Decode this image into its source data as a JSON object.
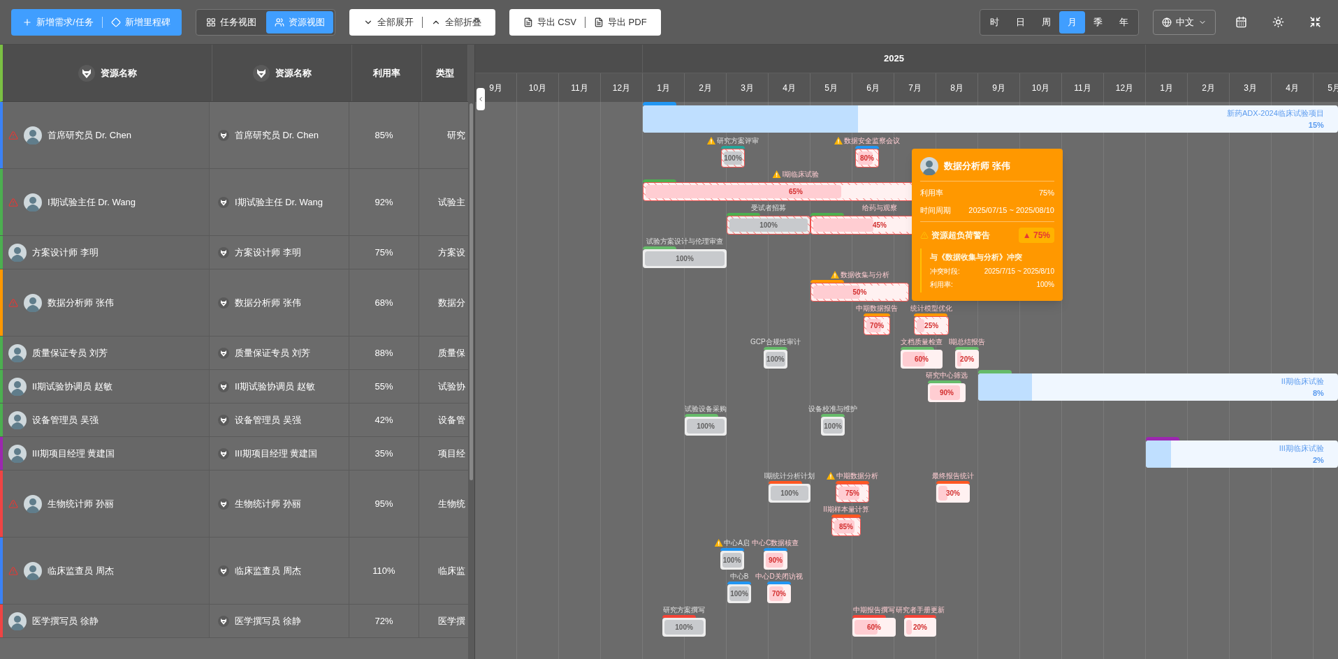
{
  "toolbar": {
    "create_buttons": [
      "新增需求/任务",
      "新增里程碑"
    ],
    "views": [
      {
        "label": "任务视图",
        "selected": false,
        "kind": "grid"
      },
      {
        "label": "资源视图",
        "selected": true,
        "kind": "users"
      }
    ],
    "expand_buttons": [
      {
        "label": "全部展开",
        "kind": "down"
      },
      {
        "label": "全部折叠",
        "kind": "up"
      }
    ],
    "export_buttons": [
      "导出 CSV",
      "导出 PDF"
    ],
    "scales": [
      {
        "label": "时",
        "selected": false
      },
      {
        "label": "日",
        "selected": false
      },
      {
        "label": "周",
        "selected": false
      },
      {
        "label": "月",
        "selected": true
      },
      {
        "label": "季",
        "selected": false
      },
      {
        "label": "年",
        "selected": false
      }
    ],
    "language": "中文"
  },
  "table": {
    "columns": [
      "资源名称",
      "资源名称",
      "利用率",
      "类型"
    ],
    "rows": [
      {
        "name": "首席研究员 Dr. Chen",
        "resource": "首席研究员 Dr. Chen",
        "utilization": "85%",
        "type": "研究",
        "color": "#3b82f6",
        "warning": true
      },
      {
        "name": "I期试验主任 Dr. Wang",
        "resource": "I期试验主任 Dr. Wang",
        "utilization": "92%",
        "type": "试验主",
        "color": "#4caf50",
        "warning": true
      },
      {
        "name": "方案设计师 李明",
        "resource": "方案设计师 李明",
        "utilization": "75%",
        "type": "方案设",
        "color": "#4caf50",
        "warning": false
      },
      {
        "name": "数据分析师 张伟",
        "resource": "数据分析师 张伟",
        "utilization": "68%",
        "type": "数据分",
        "color": "#ff9800",
        "warning": true
      },
      {
        "name": "质量保证专员 刘芳",
        "resource": "质量保证专员 刘芳",
        "utilization": "88%",
        "type": "质量保",
        "color": "#4caf50",
        "warning": false
      },
      {
        "name": "II期试验协调员 赵敏",
        "resource": "II期试验协调员 赵敏",
        "utilization": "55%",
        "type": "试验协",
        "color": "#4caf50",
        "warning": false
      },
      {
        "name": "设备管理员 吴强",
        "resource": "设备管理员 吴强",
        "utilization": "42%",
        "type": "设备管",
        "color": "#4caf50",
        "warning": false
      },
      {
        "name": "III期项目经理 黄建国",
        "resource": "III期项目经理 黄建国",
        "utilization": "35%",
        "type": "项目经",
        "color": "#9c27b0",
        "warning": false
      },
      {
        "name": "生物统计师 孙丽",
        "resource": "生物统计师 孙丽",
        "utilization": "95%",
        "type": "生物统",
        "color": "#ef4444",
        "warning": true
      },
      {
        "name": "临床监查员 周杰",
        "resource": "临床监查员 周杰",
        "utilization": "110%",
        "type": "临床监",
        "color": "#3b82f6",
        "warning": true
      },
      {
        "name": "医学撰写员 徐静",
        "resource": "医学撰写员 徐静",
        "utilization": "72%",
        "type": "医学撰",
        "color": "#ef4444",
        "warning": false
      }
    ]
  },
  "timeline": {
    "groups": [
      {
        "months": [
          "9月",
          "10月",
          "11月",
          "12月"
        ]
      },
      {
        "label": "2025",
        "months": [
          "1月",
          "2月",
          "3月",
          "4月",
          "5月",
          "6月",
          "7月",
          "8月",
          "9月",
          "10月",
          "11月",
          "12月"
        ]
      },
      {
        "months": [
          "1月",
          "2月",
          "3月",
          "4月",
          "5月"
        ]
      }
    ],
    "rows": [
      {
        "lanes": [
          [
            {
              "kind": "project",
              "name": "新药ADX-2024临床试验项目",
              "percent": "15%",
              "level": 0.31,
              "color": "#2196f3"
            }
          ],
          [
            {
              "kind": "task",
              "name": "研究方案评审",
              "percent": "100%",
              "level": 1,
              "color": "#26a69a",
              "overloaded": false,
              "conflict": true,
              "warning": true
            },
            {
              "kind": "task",
              "name": "数据安全监察会议",
              "percent": "80%",
              "level": 0.8,
              "color": "#2196f3",
              "overloaded": true,
              "conflict": true,
              "warning": true
            }
          ]
        ]
      },
      {
        "lanes": [
          [
            {
              "kind": "task",
              "name": "I期临床试验",
              "percent": "65%",
              "level": 0.65,
              "color": "#4caf50",
              "overloaded": true,
              "conflict": true,
              "warning": true
            }
          ],
          [
            {
              "kind": "task",
              "name": "受试者招募",
              "percent": "100%",
              "level": 1,
              "color": "#4caf50",
              "overloaded": false,
              "conflict": true,
              "warning": false
            },
            {
              "kind": "task",
              "name": "给药与观察",
              "percent": "45%",
              "level": 0.45,
              "color": "#4caf50",
              "overloaded": true,
              "conflict": true,
              "warning": false
            }
          ]
        ]
      },
      {
        "lanes": [
          [
            {
              "kind": "task",
              "name": "试验方案设计与伦理审查",
              "percent": "100%",
              "level": 1,
              "color": "#66bb6a",
              "overloaded": false,
              "conflict": false,
              "warning": false
            }
          ]
        ]
      },
      {
        "lanes": [
          [
            {
              "kind": "task",
              "name": "数据收集与分析",
              "percent": "50%",
              "level": 0.5,
              "color": "#ff9800",
              "overloaded": true,
              "conflict": true,
              "warning": true
            }
          ],
          [
            {
              "kind": "task",
              "name": "中期数据报告",
              "percent": "70%",
              "level": 0.7,
              "color": "#ff9800",
              "overloaded": true,
              "conflict": true,
              "warning": false
            },
            {
              "kind": "task",
              "name": "统计模型优化",
              "percent": "25%",
              "level": 0.25,
              "color": "#ff9800",
              "overloaded": true,
              "conflict": true,
              "warning": false
            }
          ]
        ]
      },
      {
        "lanes": [
          [
            {
              "kind": "task",
              "name": "GCP合规性审计",
              "percent": "100%",
              "level": 1,
              "color": "#66bb6a",
              "overloaded": false,
              "conflict": false,
              "warning": false
            },
            {
              "kind": "task",
              "name": "文档质量检查",
              "percent": "60%",
              "level": 0.6,
              "color": "#66bb6a",
              "overloaded": true,
              "conflict": false,
              "warning": false
            },
            {
              "kind": "task",
              "name": "I期总结报告",
              "percent": "20%",
              "level": 0.2,
              "color": "#66bb6a",
              "overloaded": true,
              "conflict": false,
              "warning": false
            }
          ]
        ]
      },
      {
        "lanes": [
          [
            {
              "kind": "task",
              "name": "研究中心筛选",
              "percent": "90%",
              "level": 0.9,
              "color": "#66bb6a",
              "overloaded": true,
              "conflict": false,
              "warning": false
            },
            {
              "kind": "project",
              "name": "II期临床试验",
              "percent": "8%",
              "level": 0.15,
              "color": "#66bb6a"
            }
          ]
        ]
      },
      {
        "lanes": [
          [
            {
              "kind": "task",
              "name": "试验设备采购",
              "percent": "100%",
              "level": 1,
              "color": "#66bb6a",
              "overloaded": false,
              "conflict": false,
              "warning": false
            },
            {
              "kind": "task",
              "name": "设备校准与维护",
              "percent": "100%",
              "level": 1,
              "color": "#66bb6a",
              "overloaded": false,
              "conflict": false,
              "warning": false
            }
          ]
        ]
      },
      {
        "lanes": [
          [
            {
              "kind": "project",
              "name": "III期临床试验",
              "percent": "2%",
              "level": 0.13,
              "color": "#9c27b0"
            }
          ]
        ]
      },
      {
        "lanes": [
          [
            {
              "kind": "task",
              "name": "I期统计分析计划",
              "percent": "100%",
              "level": 1,
              "color": "#ff5722",
              "overloaded": false,
              "conflict": false,
              "warning": false
            },
            {
              "kind": "task",
              "name": "中期数据分析",
              "percent": "75%",
              "level": 0.75,
              "color": "#ff5722",
              "overloaded": true,
              "conflict": true,
              "warning": true
            },
            {
              "kind": "task",
              "name": "最终报告统计",
              "percent": "30%",
              "level": 0.3,
              "color": "#ff5722",
              "overloaded": true,
              "conflict": false,
              "warning": false
            }
          ],
          [
            {
              "kind": "task",
              "name": "II期样本量计算",
              "percent": "85%",
              "level": 0.85,
              "color": "#ff5722",
              "overloaded": true,
              "conflict": true,
              "warning": false
            }
          ]
        ]
      },
      {
        "lanes": [
          [
            {
              "kind": "task",
              "name": "中心A启",
              "percent": "100%",
              "level": 1,
              "color": "#2196f3",
              "overloaded": false,
              "conflict": false,
              "warning": true
            },
            {
              "kind": "task",
              "name": "中心C数据核查",
              "percent": "90%",
              "level": 0.9,
              "color": "#2196f3",
              "overloaded": true,
              "conflict": false,
              "warning": false
            }
          ],
          [
            {
              "kind": "task",
              "name": "中心B",
              "percent": "100%",
              "level": 1,
              "color": "#2196f3",
              "overloaded": false,
              "conflict": false,
              "warning": false
            },
            {
              "kind": "task",
              "name": "中心D关闭访视",
              "percent": "70%",
              "level": 0.7,
              "color": "#2196f3",
              "overloaded": true,
              "conflict": false,
              "warning": false
            }
          ]
        ]
      },
      {
        "lanes": [
          [
            {
              "kind": "task",
              "name": "研究方案撰写",
              "percent": "100%",
              "level": 1,
              "color": "#f44336",
              "overloaded": false,
              "conflict": false,
              "warning": false
            },
            {
              "kind": "task",
              "name": "中期报告撰写",
              "percent": "60%",
              "level": 0.6,
              "color": "#f44336",
              "overloaded": true,
              "conflict": false,
              "warning": false
            },
            {
              "kind": "task",
              "name": "研究者手册更新",
              "percent": "20%",
              "level": 0.2,
              "color": "#f44336",
              "overloaded": true,
              "conflict": false,
              "warning": false
            }
          ]
        ]
      }
    ]
  },
  "tooltip": {
    "title": "数据分析师 张伟",
    "rows": [
      {
        "label": "利用率",
        "value": "75%"
      },
      {
        "label": "时间周期",
        "value": "2025/07/15 ~ 2025/08/10"
      }
    ],
    "warning": {
      "title": "资源超负荷警告",
      "badge": "▲ 75%"
    },
    "conflict": {
      "title": "与《数据收集与分析》冲突",
      "rows": [
        {
          "label": "冲突时段:",
          "value": "2025/7/15 ~ 2025/8/10"
        },
        {
          "label": "利用率:",
          "value": "100%"
        }
      ]
    }
  }
}
